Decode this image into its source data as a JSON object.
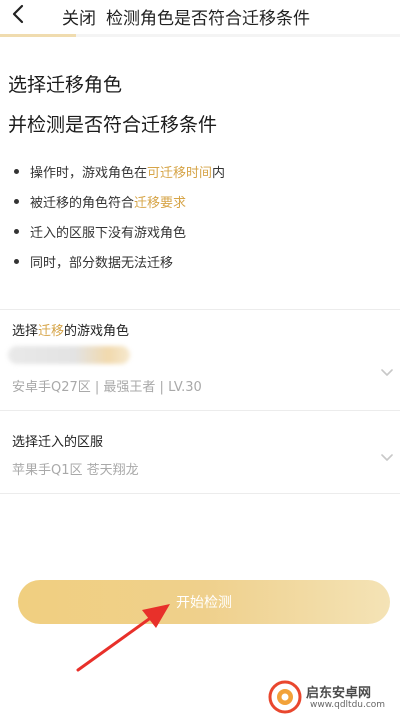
{
  "header": {
    "back_icon": "chevron-left-icon",
    "close_label": "关闭",
    "title": "检测角色是否符合迁移条件",
    "accent_color": "#f0dcaf"
  },
  "main": {
    "title_line1": "选择迁移角色",
    "title_line2": "并检测是否符合迁移条件",
    "bullets": [
      {
        "before": "操作时，游戏角色在",
        "highlight": "可迁移时间",
        "after": "内"
      },
      {
        "before": "被迁移的角色符合",
        "highlight": "迁移要求",
        "after": ""
      },
      {
        "before": "迁入的区服下没有游戏角色",
        "highlight": "",
        "after": ""
      },
      {
        "before": "同时，部分数据无法迁移",
        "highlight": "",
        "after": ""
      }
    ],
    "highlight_color": "#d6a447"
  },
  "form": {
    "role_field": {
      "label_before": "选择",
      "label_highlight": "迁移",
      "label_after": "的游戏角色",
      "value": "安卓手Q27区 | 最强王者 | LV.30"
    },
    "server_field": {
      "label": "选择迁入的区服",
      "value": "苹果手Q1区 苍天翔龙"
    }
  },
  "actions": {
    "start_button_label": "开始检测",
    "button_color": "#f0cf80"
  },
  "watermark": {
    "name": "启东安卓网",
    "url": "www.qdltdu.com"
  }
}
